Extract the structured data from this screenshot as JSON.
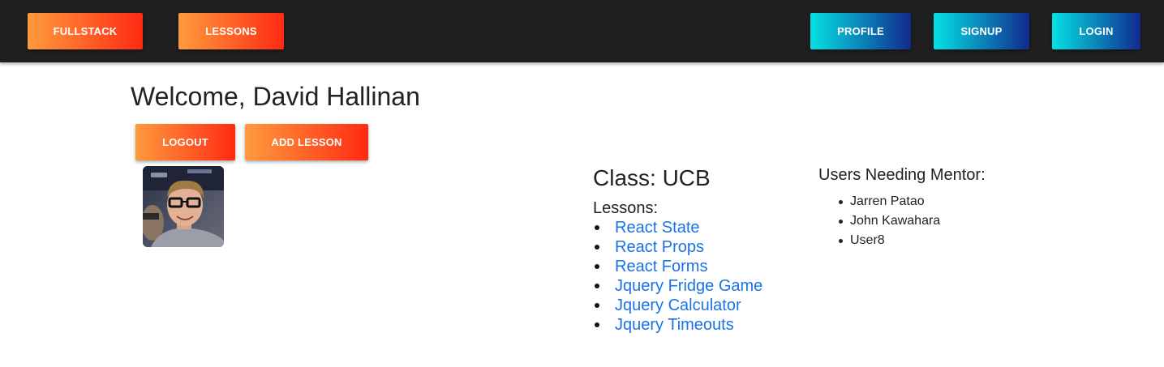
{
  "nav": {
    "fullstack": "FULLSTACK",
    "lessons": "LESSONS",
    "profile": "PROFILE",
    "signup": "SIGNUP",
    "login": "LOGIN"
  },
  "welcome": "Welcome, David Hallinan",
  "actions": {
    "logout": "LOGOUT",
    "add_lesson": "ADD LESSON"
  },
  "avatar": {
    "icon": "user-photo"
  },
  "class": {
    "title": "Class: UCB",
    "lessons_label": "Lessons:",
    "lessons": [
      "React State",
      "React Props",
      "React Forms",
      "Jquery Fridge Game",
      "Jquery Calculator",
      "Jquery Timeouts"
    ]
  },
  "mentor": {
    "title": "Users Needing Mentor:",
    "users": [
      "Jarren Patao",
      "John Kawahara",
      "User8"
    ]
  },
  "colors": {
    "navbar_bg": "#1f1f1f",
    "warm_start": "#ff9b3d",
    "warm_end": "#ff2a12",
    "cool_start": "#05e1e3",
    "cool_end": "#112a8f",
    "link": "#1a73e8"
  }
}
